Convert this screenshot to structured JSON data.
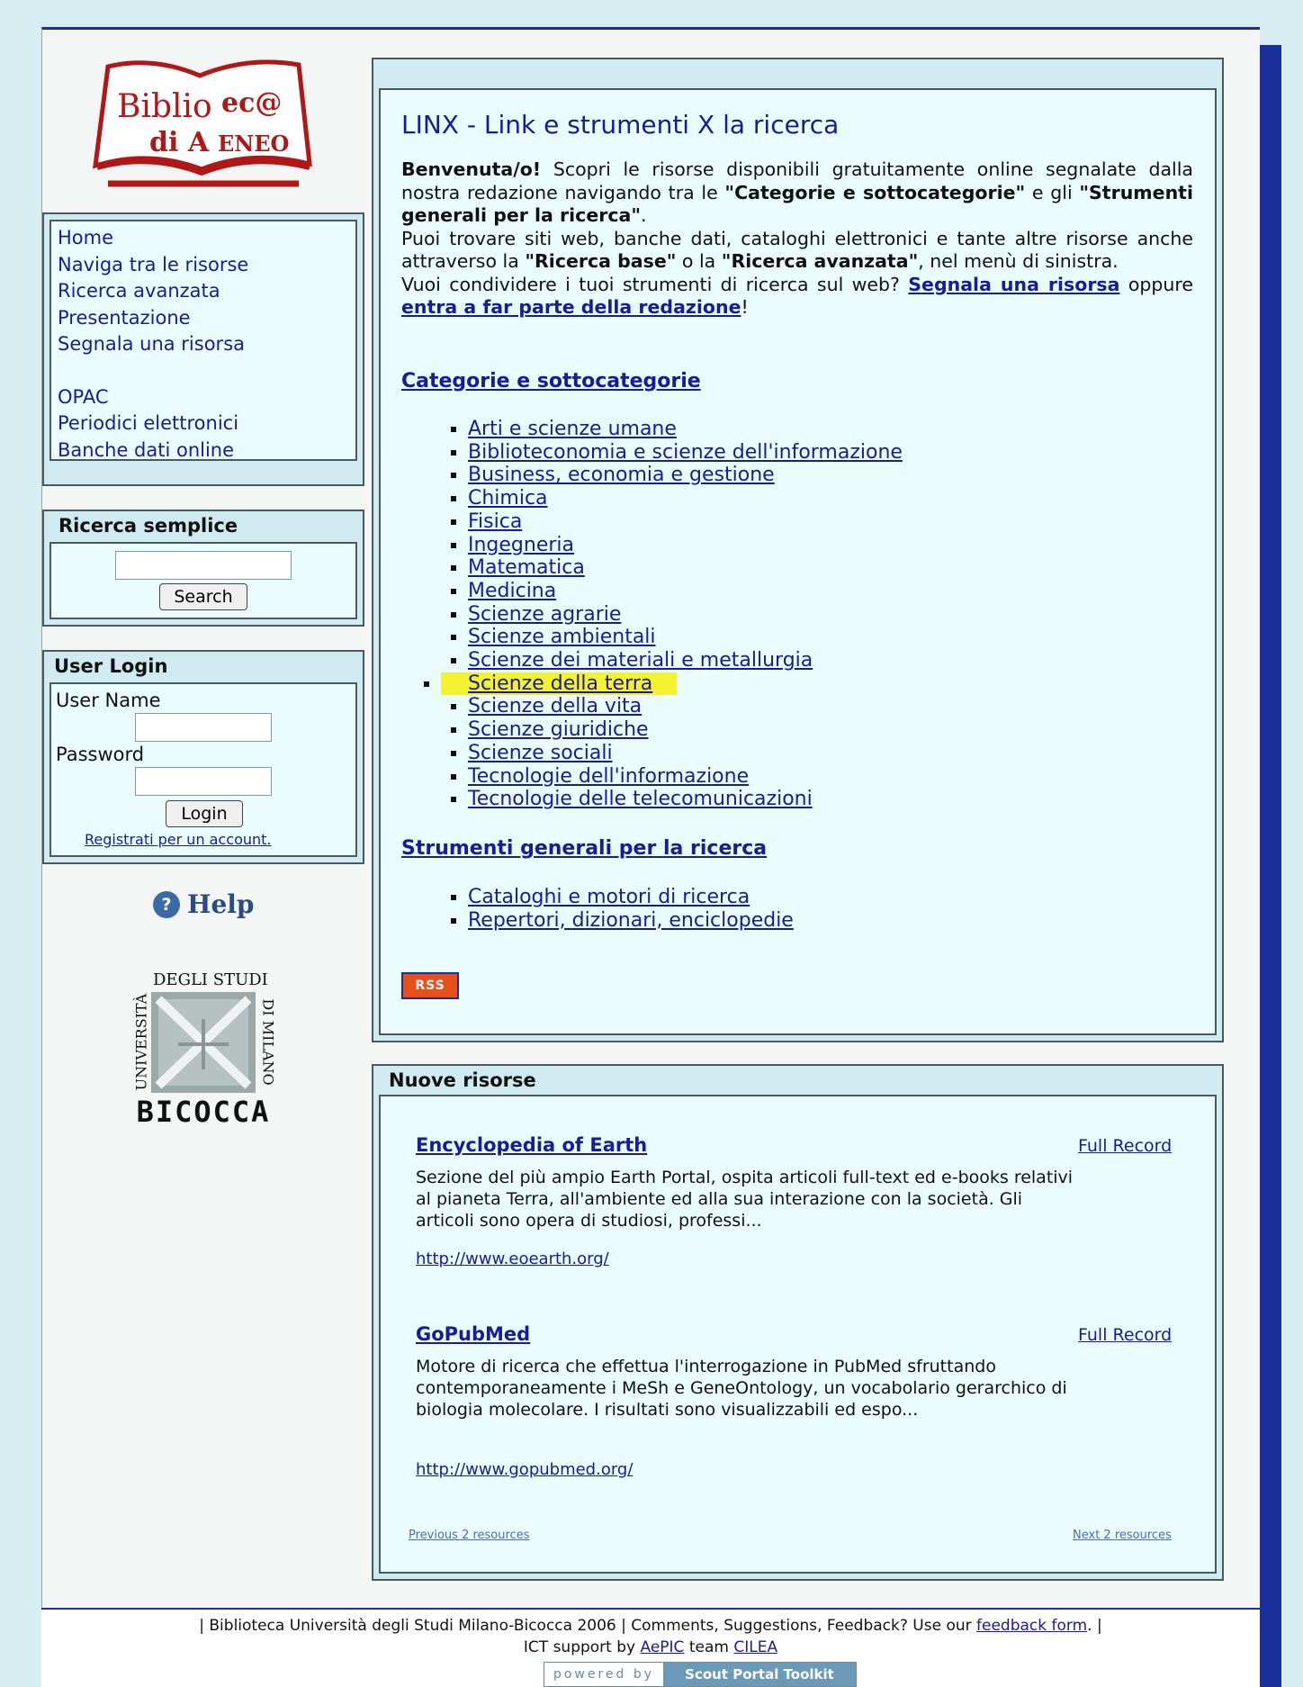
{
  "logo": {
    "line1": "Biblio",
    "line1b": "ec@",
    "line2": "di A",
    "line2b": "ENEO"
  },
  "nav": {
    "items": [
      "Home",
      "Naviga tra le risorse",
      "Ricerca avanzata",
      "Presentazione",
      "Segnala una risorsa"
    ],
    "items2": [
      "OPAC",
      "Periodici elettronici",
      "Banche dati online"
    ]
  },
  "search": {
    "title": "Ricerca semplice",
    "value": "",
    "button": "Search"
  },
  "login": {
    "title": "User Login",
    "username_label": "User Name",
    "password_label": "Password",
    "button": "Login",
    "register": "Registrati per un account."
  },
  "help": {
    "label": "Help"
  },
  "uni_logo": {
    "top": "DEGLI STUDI",
    "left": "UNIVERSITÀ",
    "right": "DI MILANO",
    "bottom": "BICOCCA"
  },
  "main": {
    "title": "LINX - Link e strumenti X la ricerca",
    "intro": {
      "p1_a": "Benvenuta/o!",
      "p1_b": " Scopri le risorse disponibili gratuitamente online segnalate dalla nostra redazione navigando tra le ",
      "p1_c": "\"Categorie e sottocategorie\"",
      "p1_d": " e gli ",
      "p1_e": "\"Strumenti generali per la ricerca\"",
      "p1_f": ".",
      "p2_a": "Puoi trovare siti web, banche dati, cataloghi elettronici e tante altre risorse anche attraverso la ",
      "p2_b": "\"Ricerca base\"",
      "p2_c": " o la ",
      "p2_d": "\"Ricerca avanzata\"",
      "p2_e": ", nel menù di sinistra.",
      "p3_a": "Vuoi condividere i tuoi strumenti di ricerca sul web? ",
      "p3_link1": "Segnala una risorsa",
      "p3_b": " oppure ",
      "p3_link2": "entra a far parte della redazione",
      "p3_c": "!"
    },
    "categories_title": "Categorie e sottocategorie",
    "categories": [
      "Arti e scienze umane",
      "Biblioteconomia e scienze dell'informazione",
      "Business, economia e gestione",
      "Chimica",
      "Fisica",
      "Ingegneria",
      "Matematica",
      "Medicina",
      "Scienze agrarie",
      "Scienze ambientali",
      "Scienze dei materiali e metallurgia",
      "Scienze della terra",
      "Scienze della vita",
      "Scienze giuridiche",
      "Scienze sociali",
      "Tecnologie dell'informazione",
      "Tecnologie delle telecomunicazioni"
    ],
    "highlighted_category": "Scienze della terra",
    "tools_title": "Strumenti generali per la ricerca",
    "tools": [
      "Cataloghi e motori di ricerca",
      "Repertori, dizionari, enciclopedie"
    ],
    "rss": "RSS"
  },
  "new_resources": {
    "title": "Nuove risorse",
    "items": [
      {
        "title": "Encyclopedia of Earth",
        "full": "Full Record",
        "desc": "Sezione del più ampio Earth Portal, ospita articoli full-text ed e-books relativi al pianeta Terra, all'ambiente ed alla sua interazione con la società. Gli articoli sono opera di studiosi, professi...",
        "url": "http://www.eoearth.org/"
      },
      {
        "title": "GoPubMed",
        "full": "Full Record",
        "desc": "Motore di ricerca che effettua l'interrogazione in PubMed sfruttando contemporaneamente i MeSh e GeneOntology, un vocabolario gerarchico di biologia molecolare. I risultati sono visualizzabili ed espo...",
        "url": "http://www.gopubmed.org/"
      }
    ],
    "prev": "Previous 2 resources",
    "next": "Next 2 resources"
  },
  "footer": {
    "line1_a": "|   Biblioteca Università degli Studi Milano-Bicocca 2006   |   Comments, Suggestions, Feedback? Use our ",
    "line1_link": "feedback form",
    "line1_b": ".   |",
    "line2_a": "ICT support by ",
    "line2_link1": "AePIC",
    "line2_b": " team ",
    "line2_link2": "CILEA",
    "powered_a": "powered by",
    "powered_b": "Scout Portal Toolkit"
  },
  "colors": {
    "accent": "#1a2f9a",
    "link": "#1a1a9a",
    "highlight": "#f2f230",
    "rss": "#e8501a"
  }
}
